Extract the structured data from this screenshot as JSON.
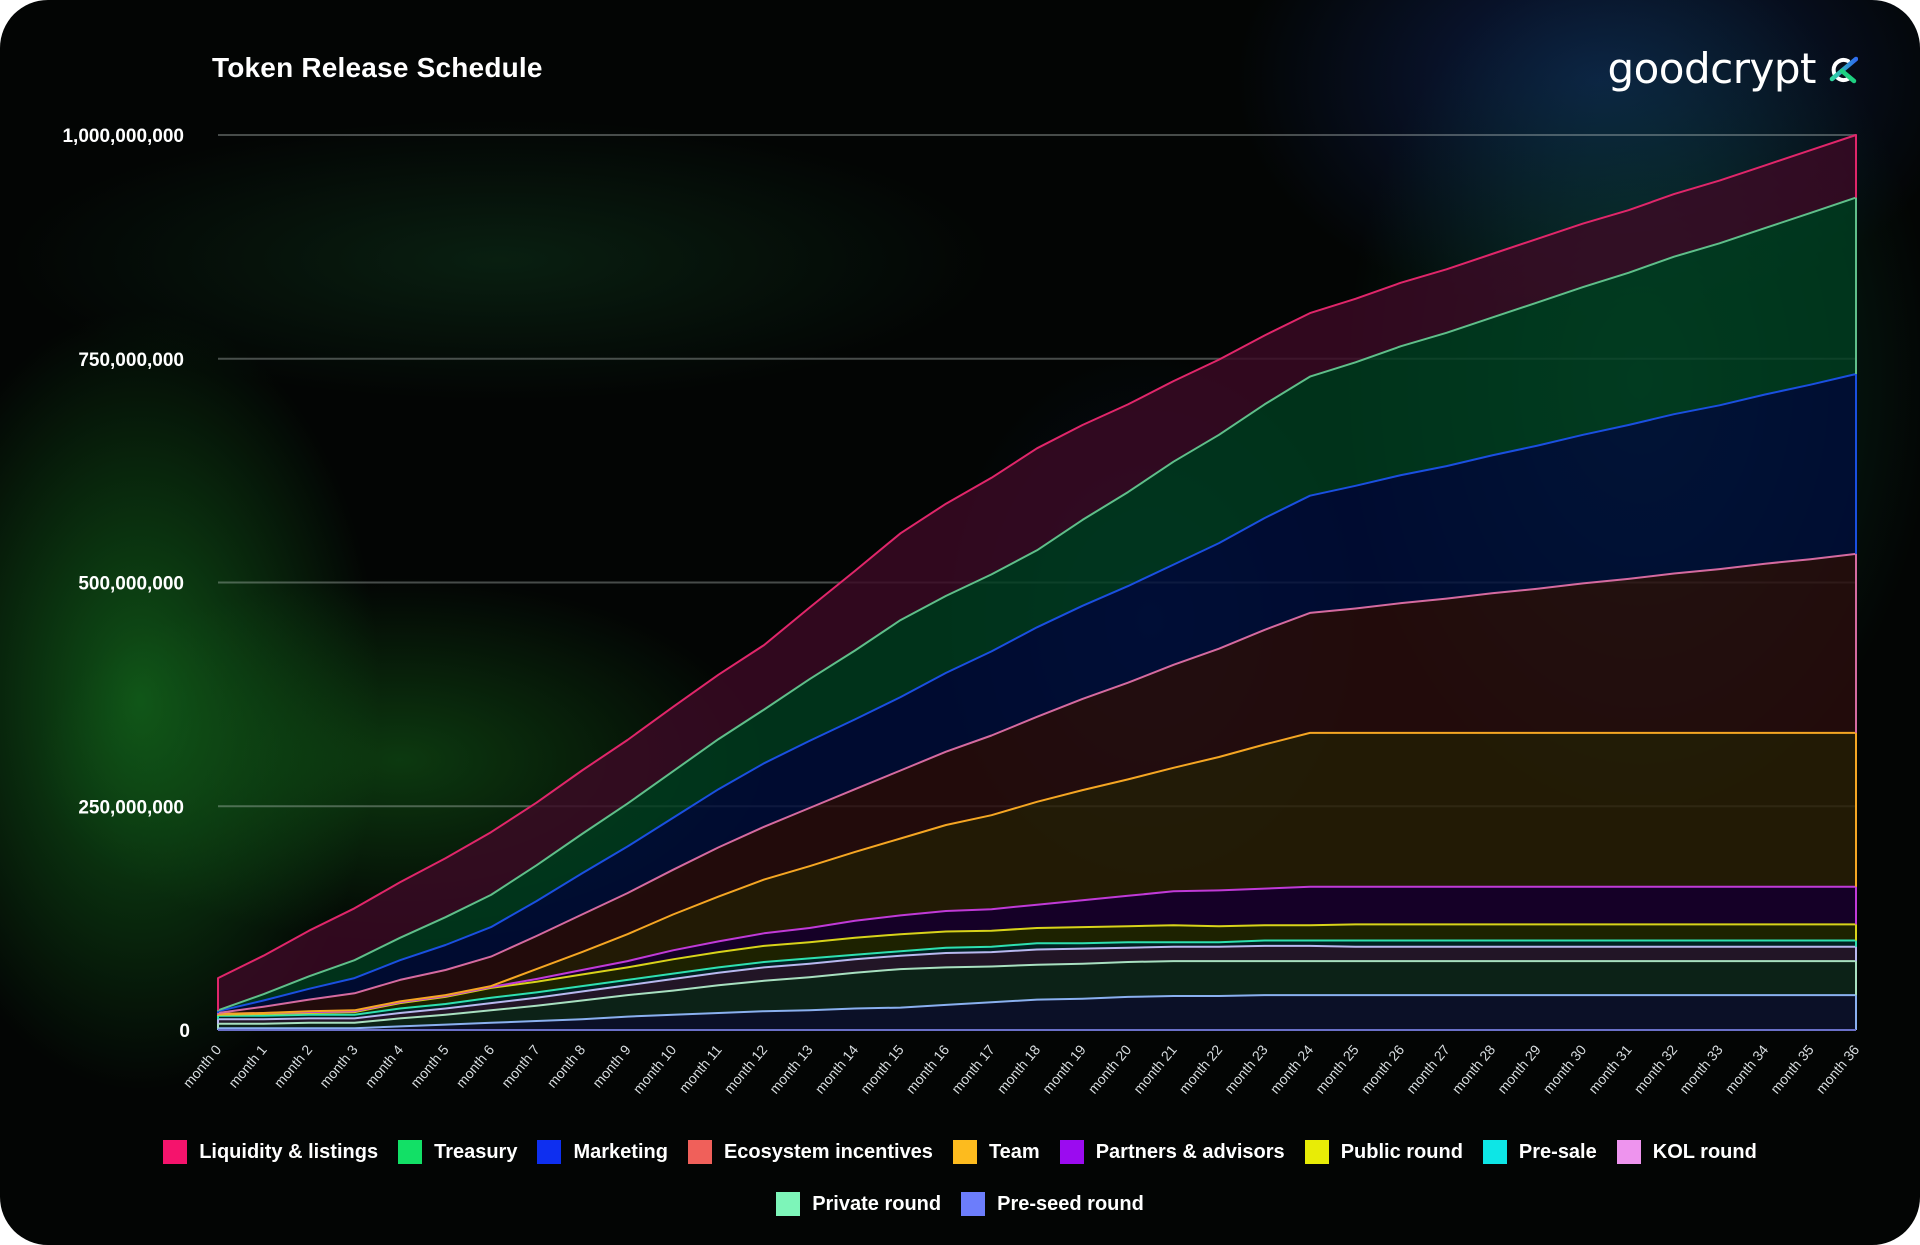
{
  "header": {
    "title": "Token Release Schedule",
    "brand": "goodcrypt",
    "brand_mark_icon": "goodcrypto-x-logo"
  },
  "chart_data": {
    "type": "area",
    "stacked": true,
    "title": "Token Release Schedule",
    "xlabel": "",
    "ylabel": "",
    "ylim": [
      0,
      1000000000
    ],
    "yticks": [
      0,
      250000000,
      500000000,
      750000000,
      1000000000
    ],
    "ytick_labels": [
      "0",
      "250,000,000",
      "500,000,000",
      "750,000,000",
      "1,000,000,000"
    ],
    "grid": true,
    "legend_position": "bottom-center",
    "categories": [
      "month 0",
      "month 1",
      "month 2",
      "month 3",
      "month 4",
      "month 5",
      "month 6",
      "month 7",
      "month 8",
      "month 9",
      "month 10",
      "month 11",
      "month 12",
      "month 13",
      "month 14",
      "month 15",
      "month 16",
      "month 17",
      "month 18",
      "month 19",
      "month 20",
      "month 21",
      "month 22",
      "month 23",
      "month 24",
      "month 25",
      "month 26",
      "month 27",
      "month 28",
      "month 29",
      "month 30",
      "month 31",
      "month 32",
      "month 33",
      "month 34",
      "month 35",
      "month 36"
    ],
    "series": [
      {
        "name": "Pre-seed round",
        "color": "#6c7dfb",
        "values": [
          2000000,
          2000000,
          2000000,
          2000000,
          4000000,
          6000000,
          8000000,
          10000000,
          12000000,
          15000000,
          17000000,
          19000000,
          21000000,
          22000000,
          24000000,
          25000000,
          28000000,
          31000000,
          34000000,
          35000000,
          37000000,
          38000000,
          38000000,
          39000000,
          39000000,
          39000000,
          39000000,
          39000000,
          39000000,
          39000000,
          39000000,
          39000000,
          39000000,
          39000000,
          39000000,
          39000000,
          39000000
        ]
      },
      {
        "name": "Private round",
        "color": "#7df5b9",
        "values": [
          5000000,
          5000000,
          6000000,
          6000000,
          9000000,
          11000000,
          14000000,
          17000000,
          21000000,
          24000000,
          27000000,
          31000000,
          34000000,
          37000000,
          40000000,
          43000000,
          42000000,
          40000000,
          39000000,
          39000000,
          39000000,
          39000000,
          39000000,
          38000000,
          38000000,
          38000000,
          38000000,
          38000000,
          38000000,
          38000000,
          38000000,
          38000000,
          38000000,
          38000000,
          38000000,
          38000000,
          38000000
        ]
      },
      {
        "name": "KOL round",
        "color": "#ee94ee",
        "values": [
          5000000,
          5000000,
          5000000,
          5000000,
          6000000,
          7000000,
          8000000,
          9000000,
          10000000,
          11000000,
          13000000,
          14000000,
          15000000,
          15000000,
          15000000,
          15000000,
          16000000,
          16000000,
          17000000,
          17000000,
          16000000,
          16000000,
          16000000,
          17000000,
          17000000,
          16000000,
          16000000,
          16000000,
          16000000,
          16000000,
          16000000,
          16000000,
          16000000,
          16000000,
          16000000,
          16000000,
          16000000
        ]
      },
      {
        "name": "Pre-sale",
        "color": "#0de6e6",
        "values": [
          4000000,
          4000000,
          4000000,
          4000000,
          5000000,
          5000000,
          6000000,
          6000000,
          6000000,
          6000000,
          6000000,
          6000000,
          6000000,
          6000000,
          5000000,
          5000000,
          6000000,
          6000000,
          7000000,
          6000000,
          6000000,
          5000000,
          5000000,
          6000000,
          6000000,
          7000000,
          7000000,
          7000000,
          7000000,
          7000000,
          7000000,
          7000000,
          7000000,
          7000000,
          7000000,
          7000000,
          7000000
        ]
      },
      {
        "name": "Public round",
        "color": "#e8ec06",
        "values": [
          1000000,
          2000000,
          2000000,
          3000000,
          6000000,
          8000000,
          11000000,
          12000000,
          13000000,
          14000000,
          16000000,
          17000000,
          18000000,
          18000000,
          19000000,
          19000000,
          18000000,
          18000000,
          17000000,
          18000000,
          18000000,
          19000000,
          18000000,
          17000000,
          17000000,
          18000000,
          18000000,
          18000000,
          18000000,
          18000000,
          18000000,
          18000000,
          18000000,
          18000000,
          18000000,
          18000000,
          18000000
        ]
      },
      {
        "name": "Partners & advisors",
        "color": "#9b0bf0",
        "values": [
          1000000,
          1000000,
          1000000,
          1000000,
          1000000,
          1000000,
          1000000,
          3000000,
          5000000,
          7000000,
          10000000,
          12000000,
          14000000,
          16000000,
          19000000,
          21000000,
          23000000,
          24000000,
          26000000,
          30000000,
          34000000,
          38000000,
          40000000,
          41000000,
          43000000,
          42000000,
          42000000,
          42000000,
          42000000,
          42000000,
          42000000,
          42000000,
          42000000,
          42000000,
          42000000,
          42000000,
          42000000
        ]
      },
      {
        "name": "Team",
        "color": "#fdbb1e",
        "values": [
          0,
          0,
          1000000,
          1000000,
          1000000,
          1000000,
          1000000,
          11000000,
          20000000,
          30000000,
          40000000,
          50000000,
          60000000,
          69000000,
          77000000,
          86000000,
          96000000,
          105000000,
          115000000,
          123000000,
          130000000,
          138000000,
          149000000,
          161000000,
          172000000,
          172000000,
          172000000,
          172000000,
          172000000,
          172000000,
          172000000,
          172000000,
          172000000,
          172000000,
          172000000,
          172000000,
          172000000
        ]
      },
      {
        "name": "Ecosystem incentives",
        "color": "#f0605a",
        "values": [
          1000000,
          7000000,
          13000000,
          19000000,
          24000000,
          28000000,
          33000000,
          37000000,
          42000000,
          46000000,
          50000000,
          55000000,
          59000000,
          65000000,
          70000000,
          76000000,
          82000000,
          89000000,
          95000000,
          102000000,
          108000000,
          115000000,
          121000000,
          128000000,
          134000000,
          139000000,
          145000000,
          150000000,
          156000000,
          161000000,
          167000000,
          172000000,
          178000000,
          183000000,
          189000000,
          194000000,
          200000000
        ]
      },
      {
        "name": "Marketing",
        "color": "#0e2ff0",
        "values": [
          2000000,
          7000000,
          12000000,
          17000000,
          22000000,
          28000000,
          33000000,
          39000000,
          46000000,
          52000000,
          58000000,
          65000000,
          71000000,
          75000000,
          78000000,
          82000000,
          88000000,
          94000000,
          100000000,
          104000000,
          108000000,
          112000000,
          118000000,
          125000000,
          131000000,
          137000000,
          143000000,
          148000000,
          154000000,
          160000000,
          166000000,
          172000000,
          178000000,
          183000000,
          189000000,
          195000000,
          201000000
        ]
      },
      {
        "name": "Treasury",
        "color": "#12e066",
        "values": [
          1000000,
          7000000,
          14000000,
          20000000,
          25000000,
          31000000,
          36000000,
          40000000,
          44000000,
          48000000,
          52000000,
          56000000,
          60000000,
          69000000,
          77000000,
          86000000,
          86000000,
          86000000,
          86000000,
          96000000,
          105000000,
          115000000,
          121000000,
          127000000,
          133000000,
          138000000,
          144000000,
          149000000,
          154000000,
          160000000,
          165000000,
          170000000,
          176000000,
          181000000,
          186000000,
          192000000,
          197000000
        ]
      },
      {
        "name": "Liquidity & listings",
        "color": "#f5136c",
        "values": [
          36000000,
          43000000,
          51000000,
          58000000,
          62000000,
          66000000,
          70000000,
          70000000,
          71000000,
          71000000,
          72000000,
          72000000,
          72000000,
          80000000,
          89000000,
          97000000,
          103000000,
          108000000,
          114000000,
          106000000,
          98000000,
          90000000,
          84000000,
          77000000,
          71000000,
          71000000,
          71000000,
          71000000,
          71000000,
          71000000,
          71000000,
          70000000,
          70000000,
          70000000,
          70000000,
          70000000,
          70000000
        ]
      }
    ],
    "legend": [
      {
        "label": "Liquidity & listings",
        "color": "#f5136c"
      },
      {
        "label": "Treasury",
        "color": "#12e066"
      },
      {
        "label": "Marketing",
        "color": "#0e2ff0"
      },
      {
        "label": "Ecosystem incentives",
        "color": "#f0605a"
      },
      {
        "label": "Team",
        "color": "#fdbb1e"
      },
      {
        "label": "Partners & advisors",
        "color": "#9b0bf0"
      },
      {
        "label": "Public round",
        "color": "#e8ec06"
      },
      {
        "label": "Pre-sale",
        "color": "#0de6e6"
      },
      {
        "label": "KOL round",
        "color": "#ee94ee"
      },
      {
        "label": "Private round",
        "color": "#7df5b9"
      },
      {
        "label": "Pre-seed round",
        "color": "#6c7dfb"
      }
    ]
  },
  "line_colors": {
    "Liquidity & listings": "#e0266a",
    "Treasury": "#5fbf8a",
    "Marketing": "#1a4fe0",
    "Ecosystem incentives": "#d56aa0",
    "Team": "#f5a623",
    "Partners & advisors": "#c03ad8",
    "Public round": "#d8d31a",
    "Pre-sale": "#2ee0b0",
    "KOL round": "#b8b8f0",
    "Private round": "#a8e0c0",
    "Pre-seed round": "#8ab0f0"
  },
  "fill_colors": {
    "Liquidity & listings": "#3a0a24",
    "Treasury": "#003d20",
    "Marketing": "#000d3a",
    "Ecosystem incentives": "#2a0e0e",
    "Team": "#2a2006",
    "Partners & advisors": "#1a0030",
    "Public round": "#232a00",
    "Pre-sale": "#002a2a",
    "KOL round": "#2a1a2e",
    "Private round": "#0f2a1c",
    "Pre-seed round": "#0e1430"
  }
}
